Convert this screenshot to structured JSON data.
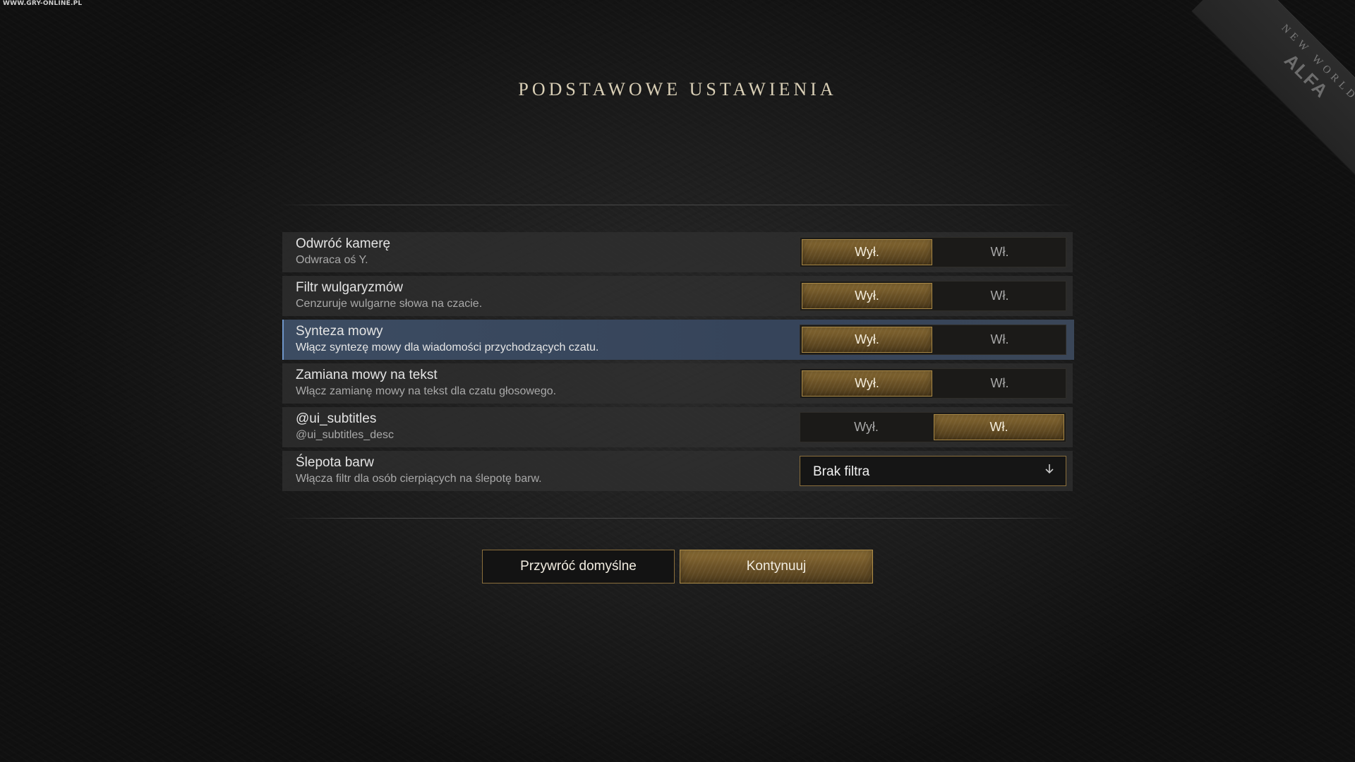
{
  "watermark": "WWW.GRY-ONLINE.PL",
  "corner": {
    "brand": "NEW WORLD",
    "tag": "ALFA"
  },
  "title": "PODSTAWOWE USTAWIENIA",
  "settings": [
    {
      "label": "Odwróć kamerę",
      "desc": "Odwraca oś Y.",
      "off": "Wył.",
      "on": "Wł.",
      "value": "off"
    },
    {
      "label": "Filtr wulgaryzmów",
      "desc": "Cenzuruje wulgarne słowa na czacie.",
      "off": "Wył.",
      "on": "Wł.",
      "value": "off"
    },
    {
      "label": "Synteza mowy",
      "desc": "Włącz syntezę mowy dla wiadomości przychodzących czatu.",
      "off": "Wył.",
      "on": "Wł.",
      "value": "off"
    },
    {
      "label": "Zamiana mowy na tekst",
      "desc": "Włącz zamianę mowy na tekst dla czatu głosowego.",
      "off": "Wył.",
      "on": "Wł.",
      "value": "off"
    },
    {
      "label": "@ui_subtitles",
      "desc": "@ui_subtitles_desc",
      "off": "Wył.",
      "on": "Wł.",
      "value": "on"
    },
    {
      "label": "Ślepota barw",
      "desc": "Włącza filtr dla osób cierpiących na ślepotę barw.",
      "dropdown_value": "Brak filtra",
      "dropdown_icon": "chevron-down-icon"
    }
  ],
  "selected_index": 2,
  "buttons": {
    "reset": "Przywróć domyślne",
    "continue": "Kontynuuj"
  },
  "colors": {
    "accent_gold": "#8a6c34",
    "selection_blue": "#6f96c9",
    "title": "#d9cfb6"
  }
}
